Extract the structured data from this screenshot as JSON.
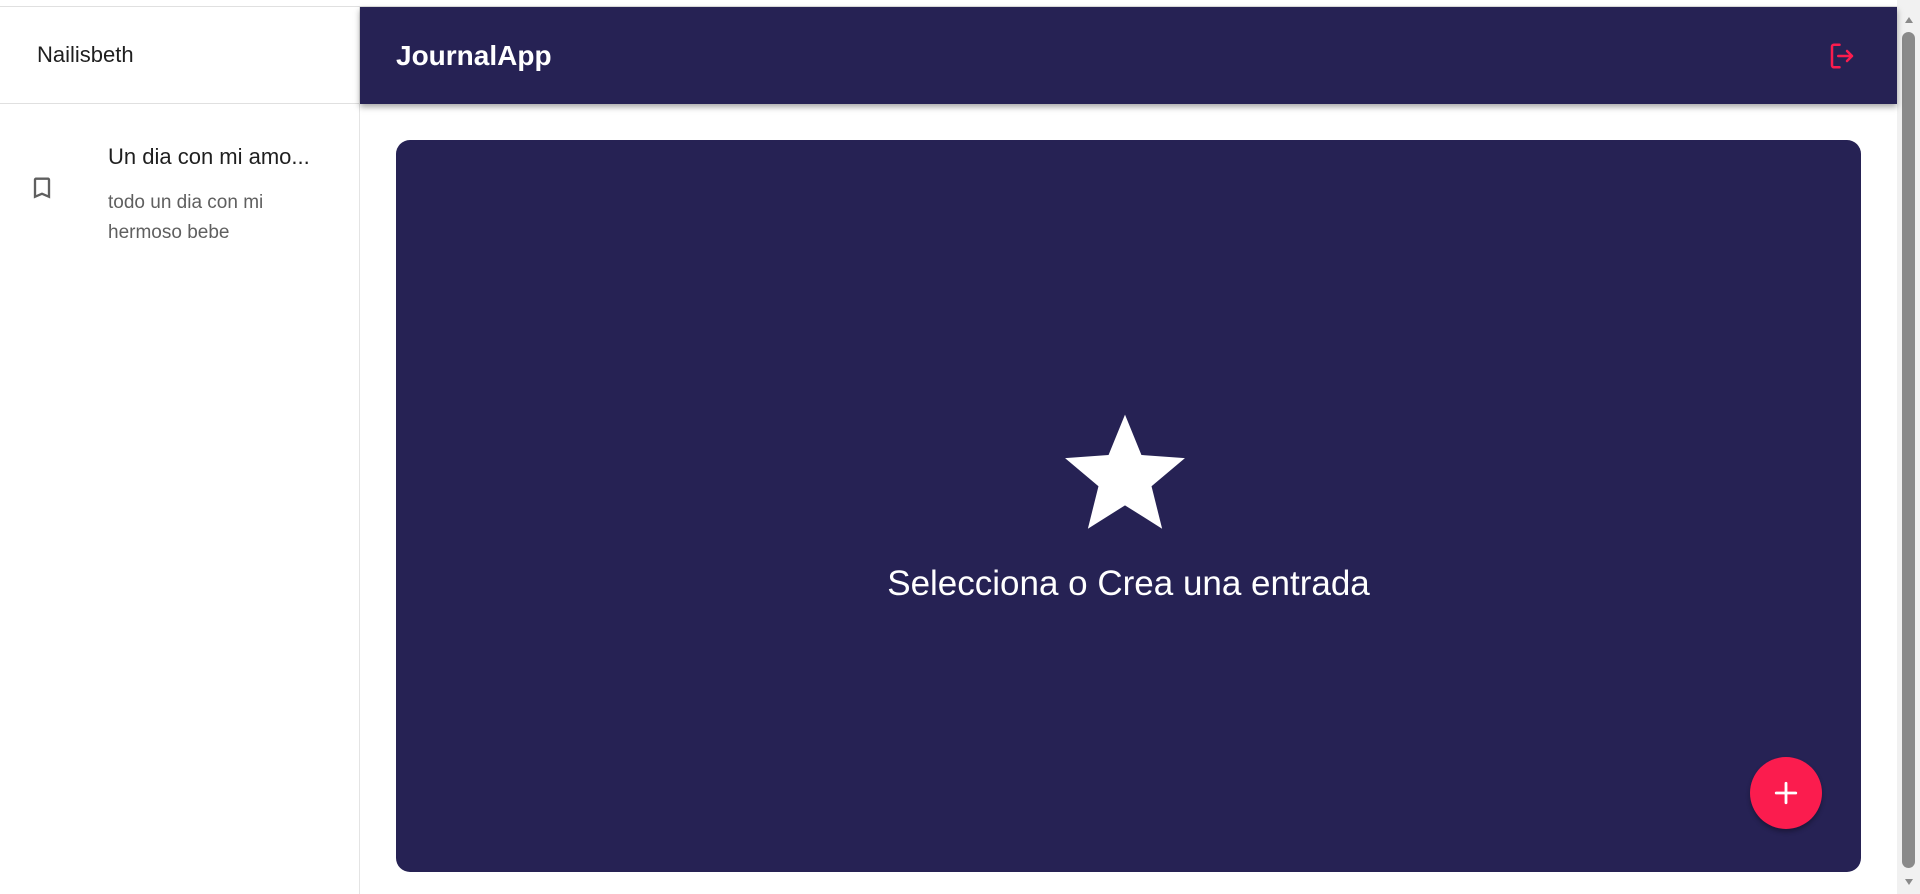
{
  "sidebar": {
    "user_name": "Nailisbeth",
    "entries": [
      {
        "title": "Un dia con mi amo...",
        "body": "todo un dia con mi hermoso bebe",
        "icon": "bookmark-icon"
      }
    ]
  },
  "appbar": {
    "title": "JournalApp",
    "logout_icon": "logout-icon"
  },
  "main": {
    "empty_message": "Selecciona o Crea una entrada",
    "empty_icon": "star-icon",
    "add_icon": "plus-icon"
  },
  "colors": {
    "primary": "#262254",
    "accent": "#fb1c4e",
    "background": "#ffffff"
  }
}
